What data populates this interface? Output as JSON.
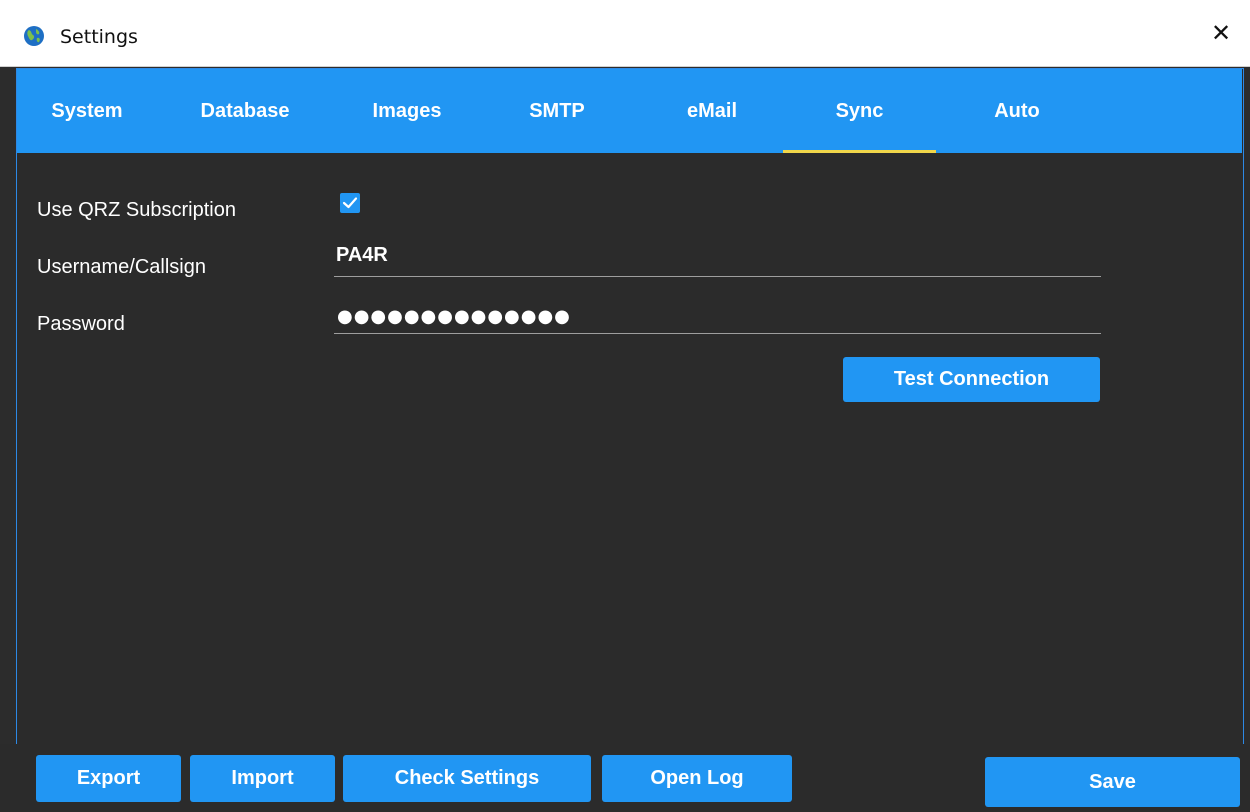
{
  "window": {
    "title": "Settings",
    "close_glyph": "✕"
  },
  "icons": {
    "app": "globe-icon",
    "close": "close-icon",
    "check": "checkmark-icon"
  },
  "colors": {
    "accent": "#2196f3",
    "active_tab_indicator": "#f1d64a",
    "background": "#2b2b2b"
  },
  "tabs": [
    {
      "label": "System",
      "active": false
    },
    {
      "label": "Database",
      "active": false
    },
    {
      "label": "Images",
      "active": false
    },
    {
      "label": "SMTP",
      "active": false
    },
    {
      "label": "eMail",
      "active": false
    },
    {
      "label": "Sync",
      "active": true
    },
    {
      "label": "Auto",
      "active": false
    }
  ],
  "sync": {
    "use_qrz_label": "Use QRZ Subscription",
    "use_qrz_checked": true,
    "username_label": "Username/Callsign",
    "username_value": "PA4R",
    "password_label": "Password",
    "password_masked": "●●●●●●●●●●●●●●",
    "test_connection_label": "Test Connection"
  },
  "footer": {
    "export_label": "Export",
    "import_label": "Import",
    "check_settings_label": "Check Settings",
    "open_log_label": "Open Log",
    "save_label": "Save"
  }
}
